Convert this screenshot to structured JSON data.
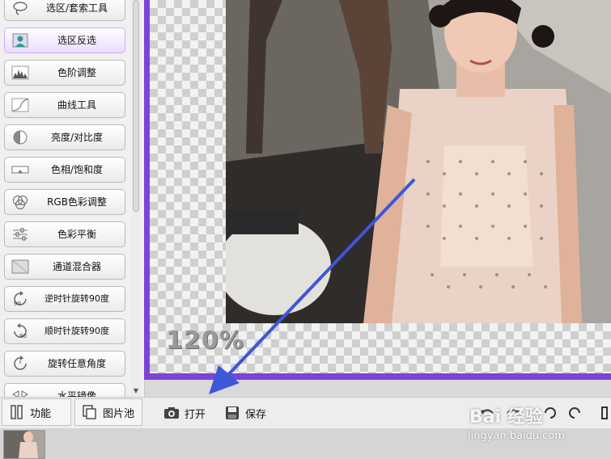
{
  "tools": [
    {
      "label": "选区/套索工具",
      "icon": "lasso-icon"
    },
    {
      "label": "选区反选",
      "icon": "invert-selection-icon",
      "active": true
    },
    {
      "label": "色阶调整",
      "icon": "levels-icon"
    },
    {
      "label": "曲线工具",
      "icon": "curves-icon"
    },
    {
      "label": "亮度/对比度",
      "icon": "brightness-contrast-icon"
    },
    {
      "label": "色相/饱和度",
      "icon": "hue-saturation-icon"
    },
    {
      "label": "RGB色彩调整",
      "icon": "rgb-icon"
    },
    {
      "label": "色彩平衡",
      "icon": "color-balance-icon"
    },
    {
      "label": "通道混合器",
      "icon": "channel-mixer-icon"
    },
    {
      "label": "逆时针旋转90度",
      "icon": "rotate-ccw-90-icon"
    },
    {
      "label": "顺时针旋转90度",
      "icon": "rotate-cw-90-icon"
    },
    {
      "label": "旋转任意角度",
      "icon": "rotate-any-icon"
    },
    {
      "label": "水平镜像",
      "icon": "flip-horizontal-icon"
    }
  ],
  "canvas": {
    "zoom": "120%",
    "border_color": "#7a45d6"
  },
  "toolbar": {
    "function_label": "功能",
    "gallery_label": "图片池",
    "open_label": "打开",
    "save_label": "保存"
  },
  "watermark": {
    "logo": "Bai 经验",
    "url": "jingyan.baidu.com"
  }
}
